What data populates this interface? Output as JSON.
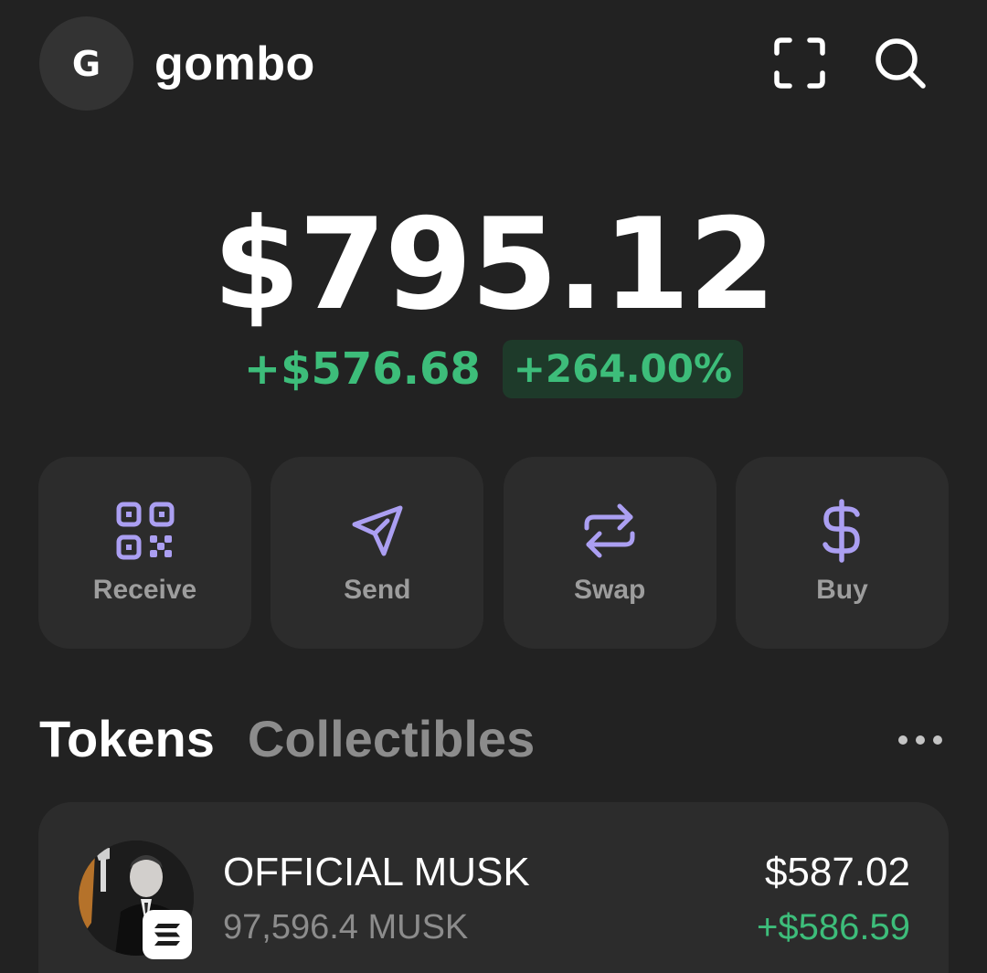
{
  "header": {
    "avatar_letter": "G",
    "account_name": "gombo",
    "scan_icon": "scan-icon",
    "search_icon": "search-icon"
  },
  "balance": {
    "total": "$795.12",
    "change_amount": "+$576.68",
    "change_percent": "+264.00%"
  },
  "actions": [
    {
      "label": "Receive",
      "icon": "qr-code-icon"
    },
    {
      "label": "Send",
      "icon": "send-icon"
    },
    {
      "label": "Swap",
      "icon": "swap-icon"
    },
    {
      "label": "Buy",
      "icon": "dollar-icon"
    }
  ],
  "tabs": {
    "tokens": "Tokens",
    "collectibles": "Collectibles",
    "active": "Tokens"
  },
  "tokens": [
    {
      "name": "OFFICIAL MUSK",
      "amount": "97,596.4 MUSK",
      "value": "$587.02",
      "change": "+$586.59",
      "chain_icon": "solana-icon"
    }
  ],
  "colors": {
    "background": "#222222",
    "card": "#2c2c2c",
    "accent": "#ab9ff2",
    "positive": "#3dbd7a",
    "muted": "#8c8c8c"
  }
}
